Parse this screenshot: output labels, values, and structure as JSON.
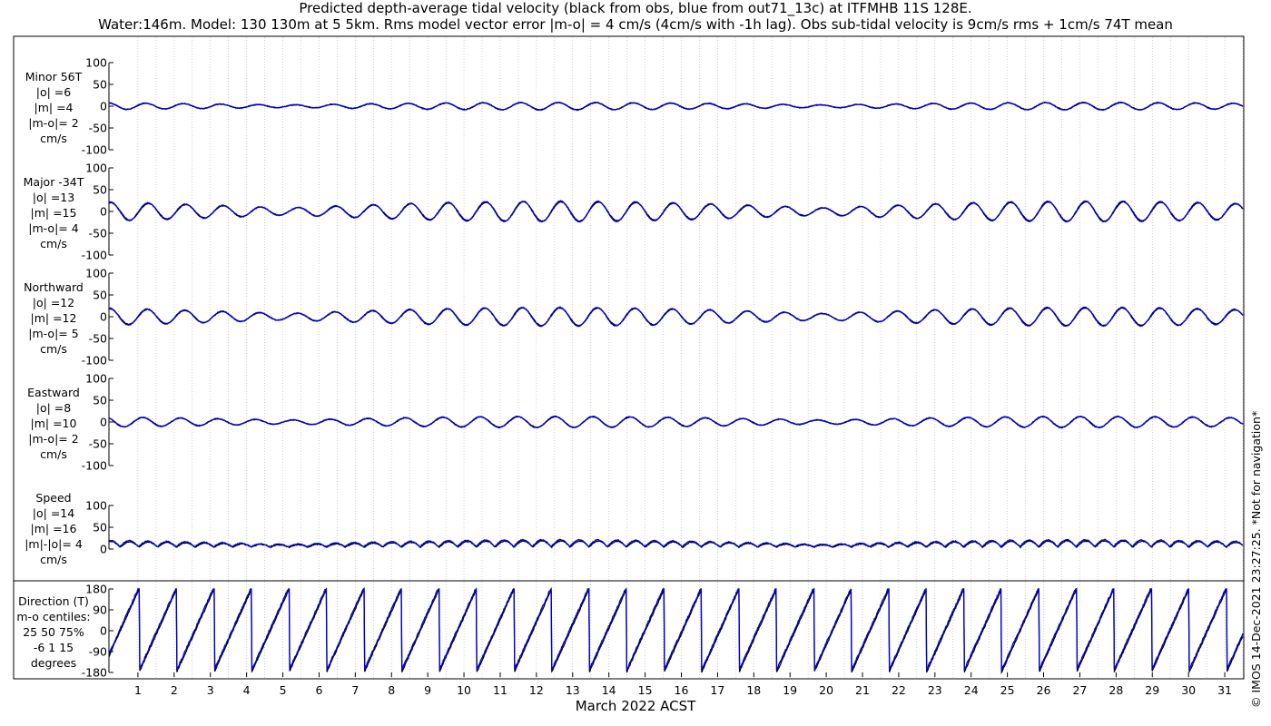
{
  "title_line1": "Predicted depth-average tidal velocity (black from obs, blue from out71_13c) at ITFMHB 11S 128E.",
  "title_line2": "Water:146m. Model: 130 130m at 5 5km. Rms model vector error |m-o| = 4 cm/s (4cm/s with -1h lag). Obs sub-tidal velocity is 9cm/s rms + 1cm/s 74T mean",
  "x_axis_label": "March 2022 ACST",
  "copyright": "© IMOS 14-Dec-2021 23:27:25. *Not for navigation*",
  "colors": {
    "obs": "#000000",
    "model": "#0000cc",
    "grid": "#b0b0b0"
  },
  "chart_data": {
    "type": "line",
    "x_ticks": [
      "1",
      "2",
      "3",
      "4",
      "5",
      "6",
      "7",
      "8",
      "9",
      "10",
      "11",
      "12",
      "13",
      "14",
      "15",
      "16",
      "17",
      "18",
      "19",
      "20",
      "21",
      "22",
      "23",
      "24",
      "25",
      "26",
      "27",
      "28",
      "29",
      "30",
      "31"
    ],
    "xlim_days": [
      0.2,
      31.5
    ],
    "panels": [
      {
        "id": "minor",
        "label_lines": [
          "Minor 56T",
          "|o| =6",
          "|m| =4",
          "|m-o|= 2",
          "cm/s"
        ],
        "ylim": [
          -100,
          100
        ],
        "yticks": [
          "100",
          "50",
          "0",
          "-50",
          "-100"
        ],
        "amplitude": 8
      },
      {
        "id": "major",
        "label_lines": [
          "Major -34T",
          "|o| =13",
          "|m| =15",
          "|m-o|= 4",
          "cm/s"
        ],
        "ylim": [
          -100,
          100
        ],
        "yticks": [
          "100",
          "50",
          "0",
          "-50",
          "-100"
        ],
        "amplitude": 22
      },
      {
        "id": "north",
        "label_lines": [
          "Northward",
          "|o| =12",
          "|m| =12",
          "|m-o|= 5",
          "cm/s"
        ],
        "ylim": [
          -100,
          100
        ],
        "yticks": [
          "100",
          "50",
          "0",
          "-50",
          "-100"
        ],
        "amplitude": 20
      },
      {
        "id": "east",
        "label_lines": [
          "Eastward",
          "|o| =8",
          "|m| =10",
          "|m-o|= 2",
          "cm/s"
        ],
        "ylim": [
          -100,
          100
        ],
        "yticks": [
          "100",
          "50",
          "0",
          "-50",
          "-100"
        ],
        "amplitude": 12
      },
      {
        "id": "speed",
        "label_lines": [
          "Speed",
          "|o| =14",
          "|m| =16",
          "|m|-|o|= 4",
          "cm/s"
        ],
        "ylim": [
          0,
          100
        ],
        "yticks": [
          "100",
          "50",
          "0"
        ],
        "amplitude": 18
      },
      {
        "id": "direction",
        "label_lines": [
          "Direction (T)",
          "m-o centiles:",
          "25  50  75%",
          "-6   1  15",
          "degrees"
        ],
        "ylim": [
          -180,
          180
        ],
        "yticks": [
          "180",
          "90",
          "0",
          "-90",
          "-180"
        ]
      }
    ]
  }
}
